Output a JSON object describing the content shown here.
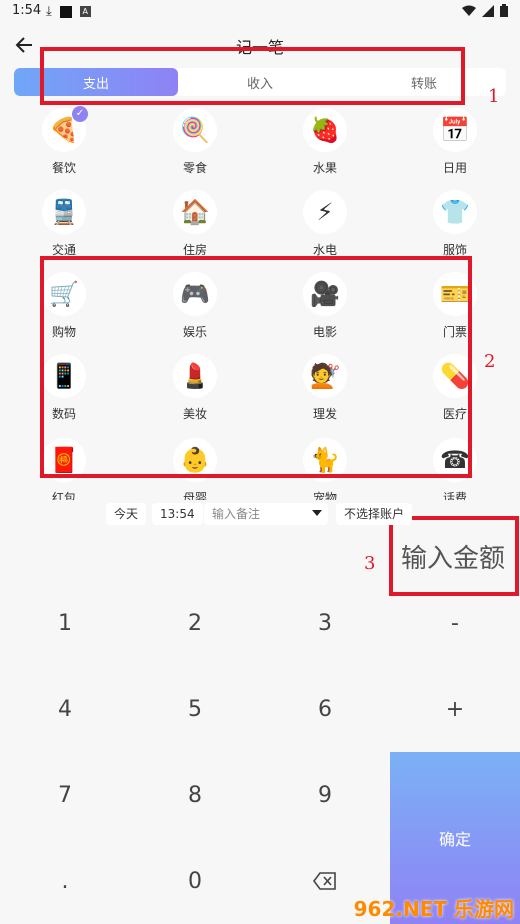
{
  "status_bar": {
    "time": "1:54"
  },
  "header": {
    "title": "记一笔"
  },
  "tabs": [
    {
      "label": "支出",
      "active": true
    },
    {
      "label": "收入",
      "active": false
    },
    {
      "label": "转账",
      "active": false
    }
  ],
  "categories": [
    {
      "label": "餐饮",
      "icon": "pizza-icon",
      "glyph": "🍕",
      "selected": true
    },
    {
      "label": "零食",
      "icon": "lollipop-icon",
      "glyph": "🍭"
    },
    {
      "label": "水果",
      "icon": "strawberry-icon",
      "glyph": "🍓"
    },
    {
      "label": "日用",
      "icon": "calendar-icon",
      "glyph": "📅"
    },
    {
      "label": "交通",
      "icon": "train-icon",
      "glyph": "🚆"
    },
    {
      "label": "住房",
      "icon": "house-icon",
      "glyph": "🏠"
    },
    {
      "label": "水电",
      "icon": "lightning-icon",
      "glyph": "⚡"
    },
    {
      "label": "服饰",
      "icon": "tshirt-icon",
      "glyph": "👕"
    },
    {
      "label": "购物",
      "icon": "cart-icon",
      "glyph": "🛒"
    },
    {
      "label": "娱乐",
      "icon": "gamepad-icon",
      "glyph": "🎮"
    },
    {
      "label": "电影",
      "icon": "movie-camera-icon",
      "glyph": "🎥"
    },
    {
      "label": "门票",
      "icon": "ticket-icon",
      "glyph": "🎫"
    },
    {
      "label": "数码",
      "icon": "phone-icon",
      "glyph": "📱"
    },
    {
      "label": "美妆",
      "icon": "lipstick-icon",
      "glyph": "💄"
    },
    {
      "label": "理发",
      "icon": "haircut-icon",
      "glyph": "💇"
    },
    {
      "label": "医疗",
      "icon": "pill-icon",
      "glyph": "💊"
    },
    {
      "label": "红包",
      "icon": "red-envelope-icon",
      "glyph": "🧧"
    },
    {
      "label": "母婴",
      "icon": "baby-icon",
      "glyph": "👶"
    },
    {
      "label": "宠物",
      "icon": "cat-icon",
      "glyph": "🐈"
    },
    {
      "label": "话费",
      "icon": "telephone-icon",
      "glyph": "☎"
    }
  ],
  "info_bar": {
    "date": "今天",
    "time": "13:54",
    "note_placeholder": "输入备注",
    "account": "不选择账户"
  },
  "amount_placeholder": "输入金额",
  "keypad": {
    "keys": [
      "1",
      "2",
      "3",
      "-",
      "4",
      "5",
      "6",
      "+",
      "7",
      "8",
      "9",
      ".",
      "0"
    ],
    "confirm": "确定"
  },
  "annotations": [
    "1",
    "2",
    "3"
  ],
  "watermark": "962.NET 乐游网",
  "colors": {
    "accent_start": "#6fa7f7",
    "accent_end": "#8f82f5",
    "annotation": "#e0192a"
  }
}
